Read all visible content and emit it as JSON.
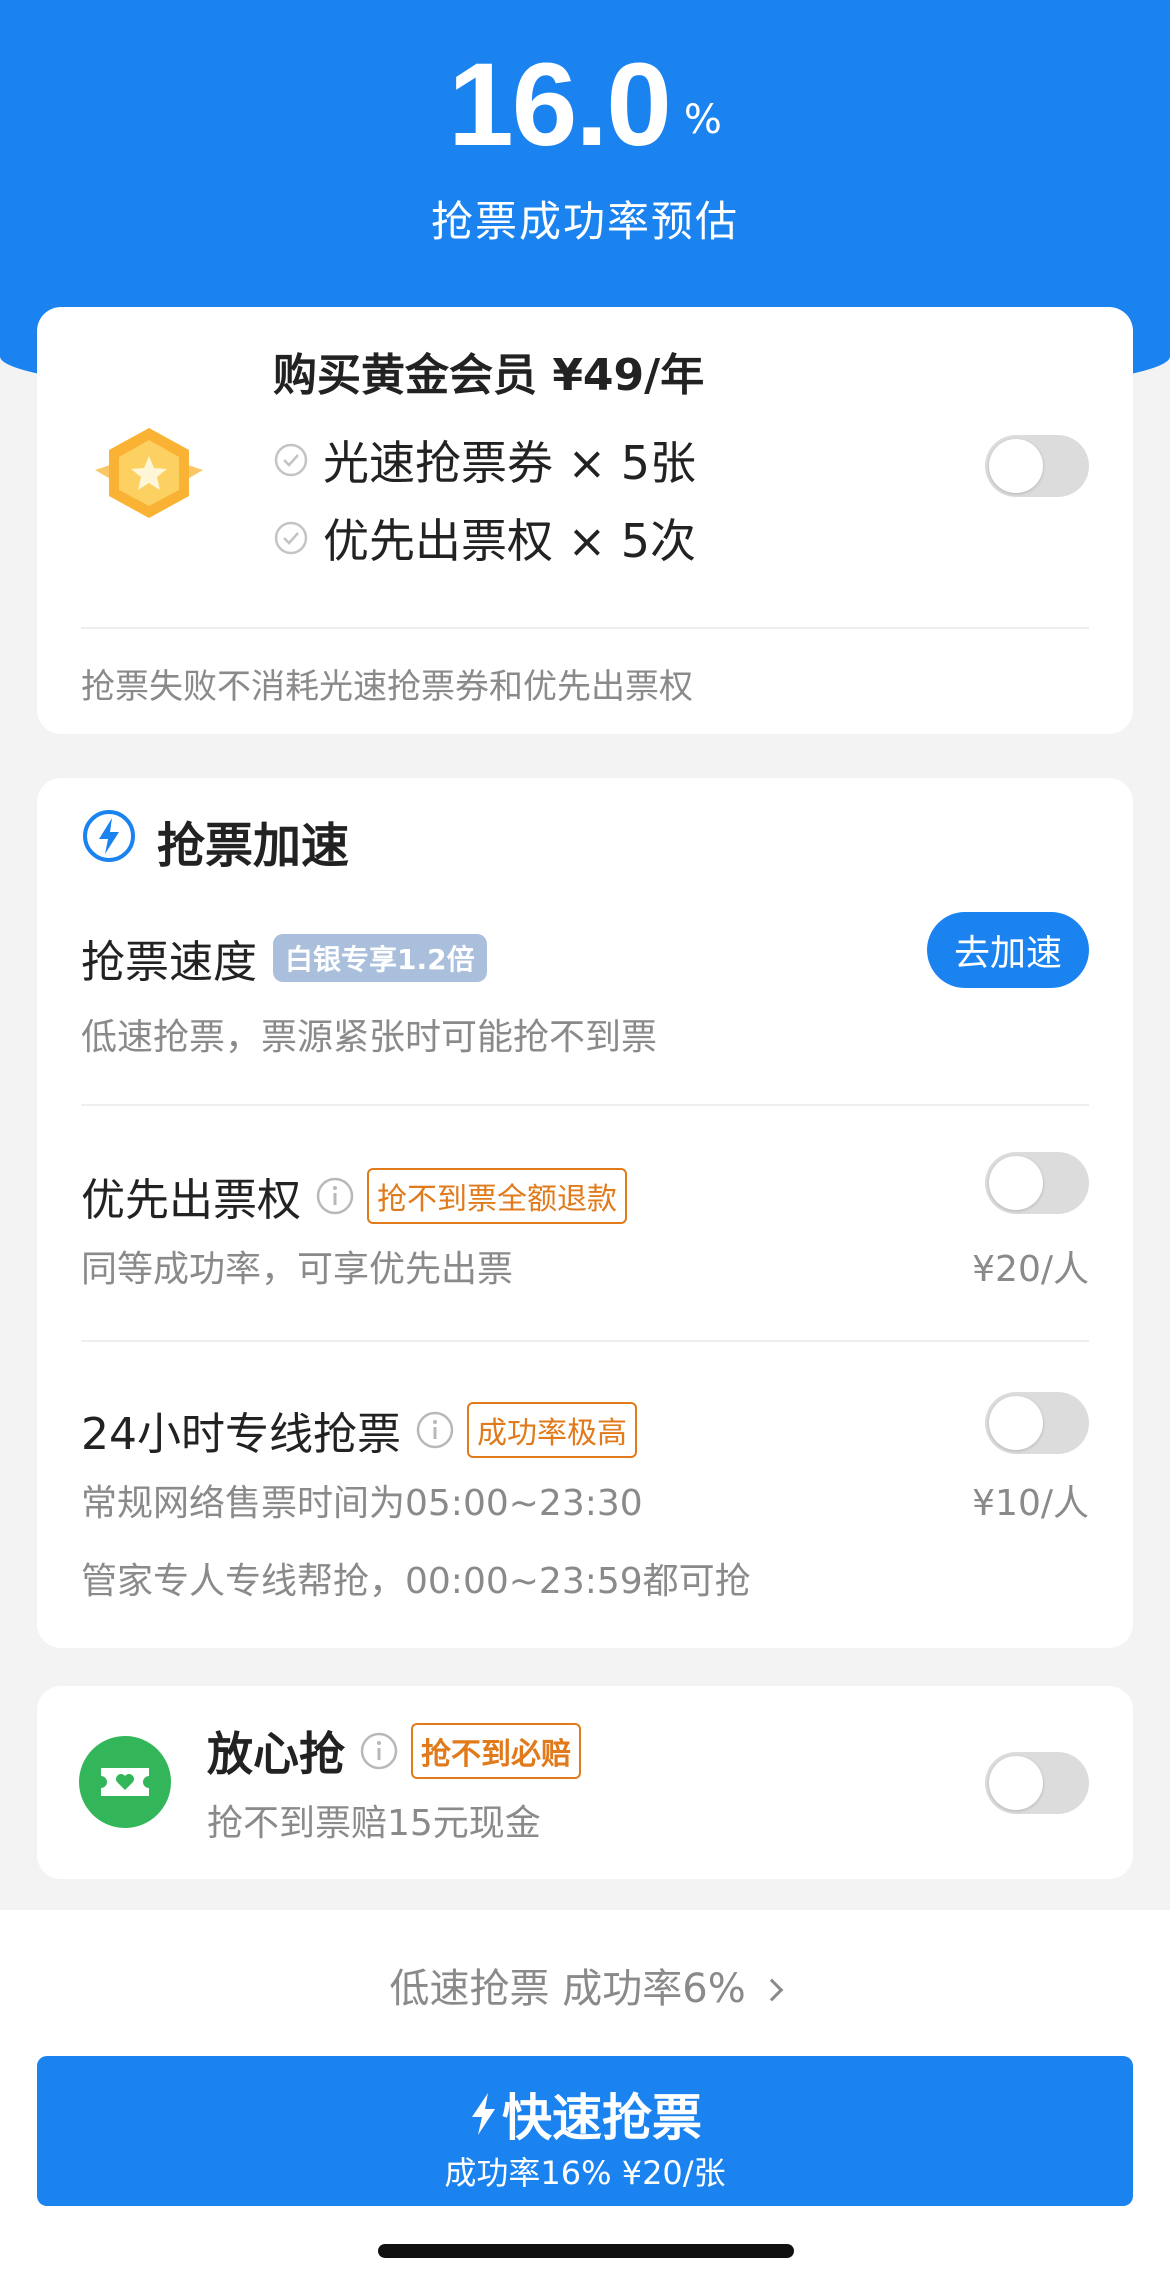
{
  "header": {
    "rate_value": "16.0",
    "rate_unit": "%",
    "rate_label": "抢票成功率预估"
  },
  "member": {
    "title": "购买黄金会员 ¥49/年",
    "benefits": [
      "光速抢票券 × 5张",
      "优先出票权 × 5次"
    ],
    "note": "抢票失败不消耗光速抢票券和优先出票权",
    "toggle_on": false
  },
  "speedup": {
    "section_title": "抢票加速",
    "speed": {
      "title": "抢票速度",
      "badge": "白银专享1.2倍",
      "sub": "低速抢票，票源紧张时可能抢不到票",
      "button": "去加速"
    },
    "priority": {
      "title": "优先出票权",
      "badge": "抢不到票全额退款",
      "sub": "同等成功率，可享优先出票",
      "price": "¥20/人",
      "toggle_on": false
    },
    "hotline": {
      "title": "24小时专线抢票",
      "badge": "成功率极高",
      "sub1": "常规网络售票时间为05:00~23:30",
      "sub2": "管家专人专线帮抢，00:00~23:59都可抢",
      "price": "¥10/人",
      "toggle_on": false
    }
  },
  "safe": {
    "title": "放心抢",
    "badge": "抢不到必赔",
    "sub": "抢不到票赔15元现金",
    "toggle_on": false
  },
  "bottom": {
    "low_link": "低速抢票 成功率6%",
    "cta_main": "快速抢票",
    "cta_sub": "成功率16% ¥20/张"
  },
  "colors": {
    "primary": "#1a83f0",
    "badge_orange": "#e07a1b",
    "badge_silver": "#a9bfdb",
    "safe_green": "#33b65a"
  }
}
